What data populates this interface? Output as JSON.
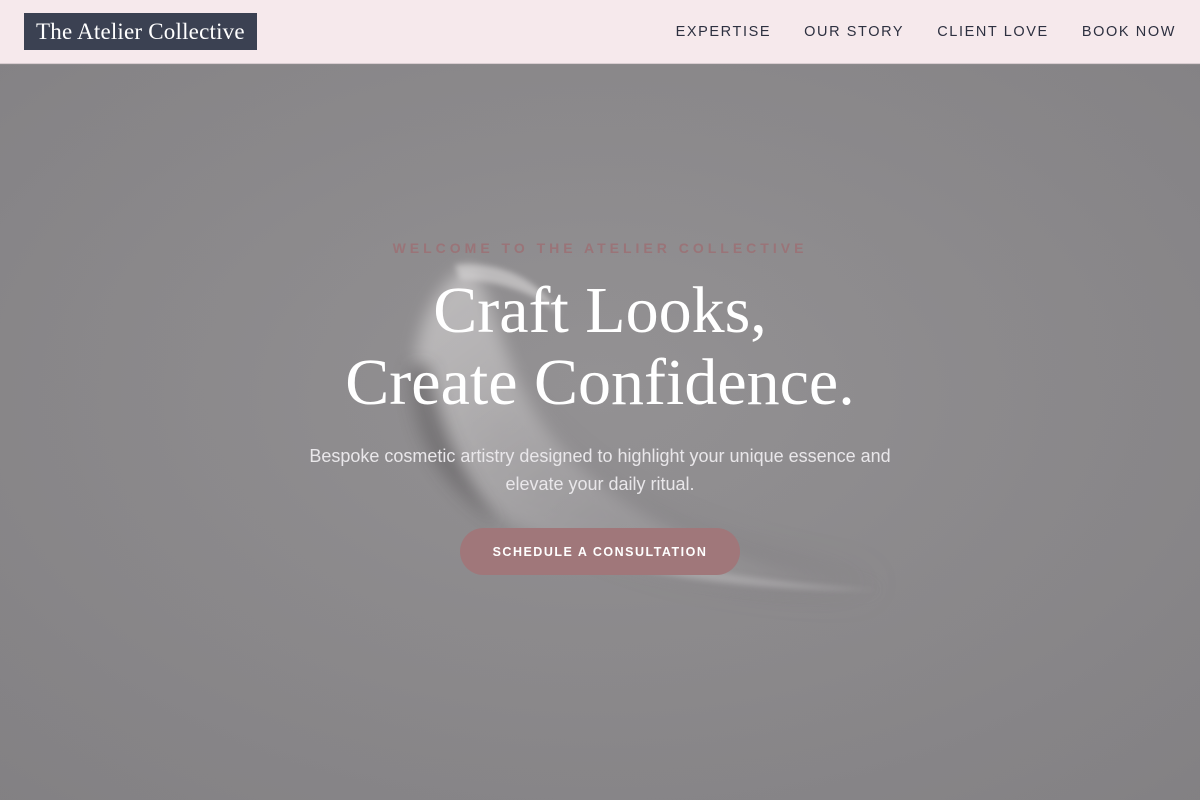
{
  "header": {
    "logo_text": "The Atelier Collective",
    "nav": [
      {
        "label": "EXPERTISE"
      },
      {
        "label": "OUR STORY"
      },
      {
        "label": "CLIENT LOVE"
      },
      {
        "label": "BOOK NOW"
      }
    ]
  },
  "hero": {
    "eyebrow": "WELCOME TO THE ATELIER COLLECTIVE",
    "headline_line1": "Craft Looks,",
    "headline_line2": "Create Confidence.",
    "subhead": "Bespoke cosmetic artistry designed to highlight your unique essence and elevate your daily ritual.",
    "cta_label": "SCHEDULE A CONSULTATION",
    "background_image": "cosmetic-cream-swatch-image"
  },
  "colors": {
    "header_bg": "#f6e9ec",
    "logo_bg": "#3b4152",
    "accent": "#a0777a",
    "hero_overlay": "#8b8a8c"
  }
}
